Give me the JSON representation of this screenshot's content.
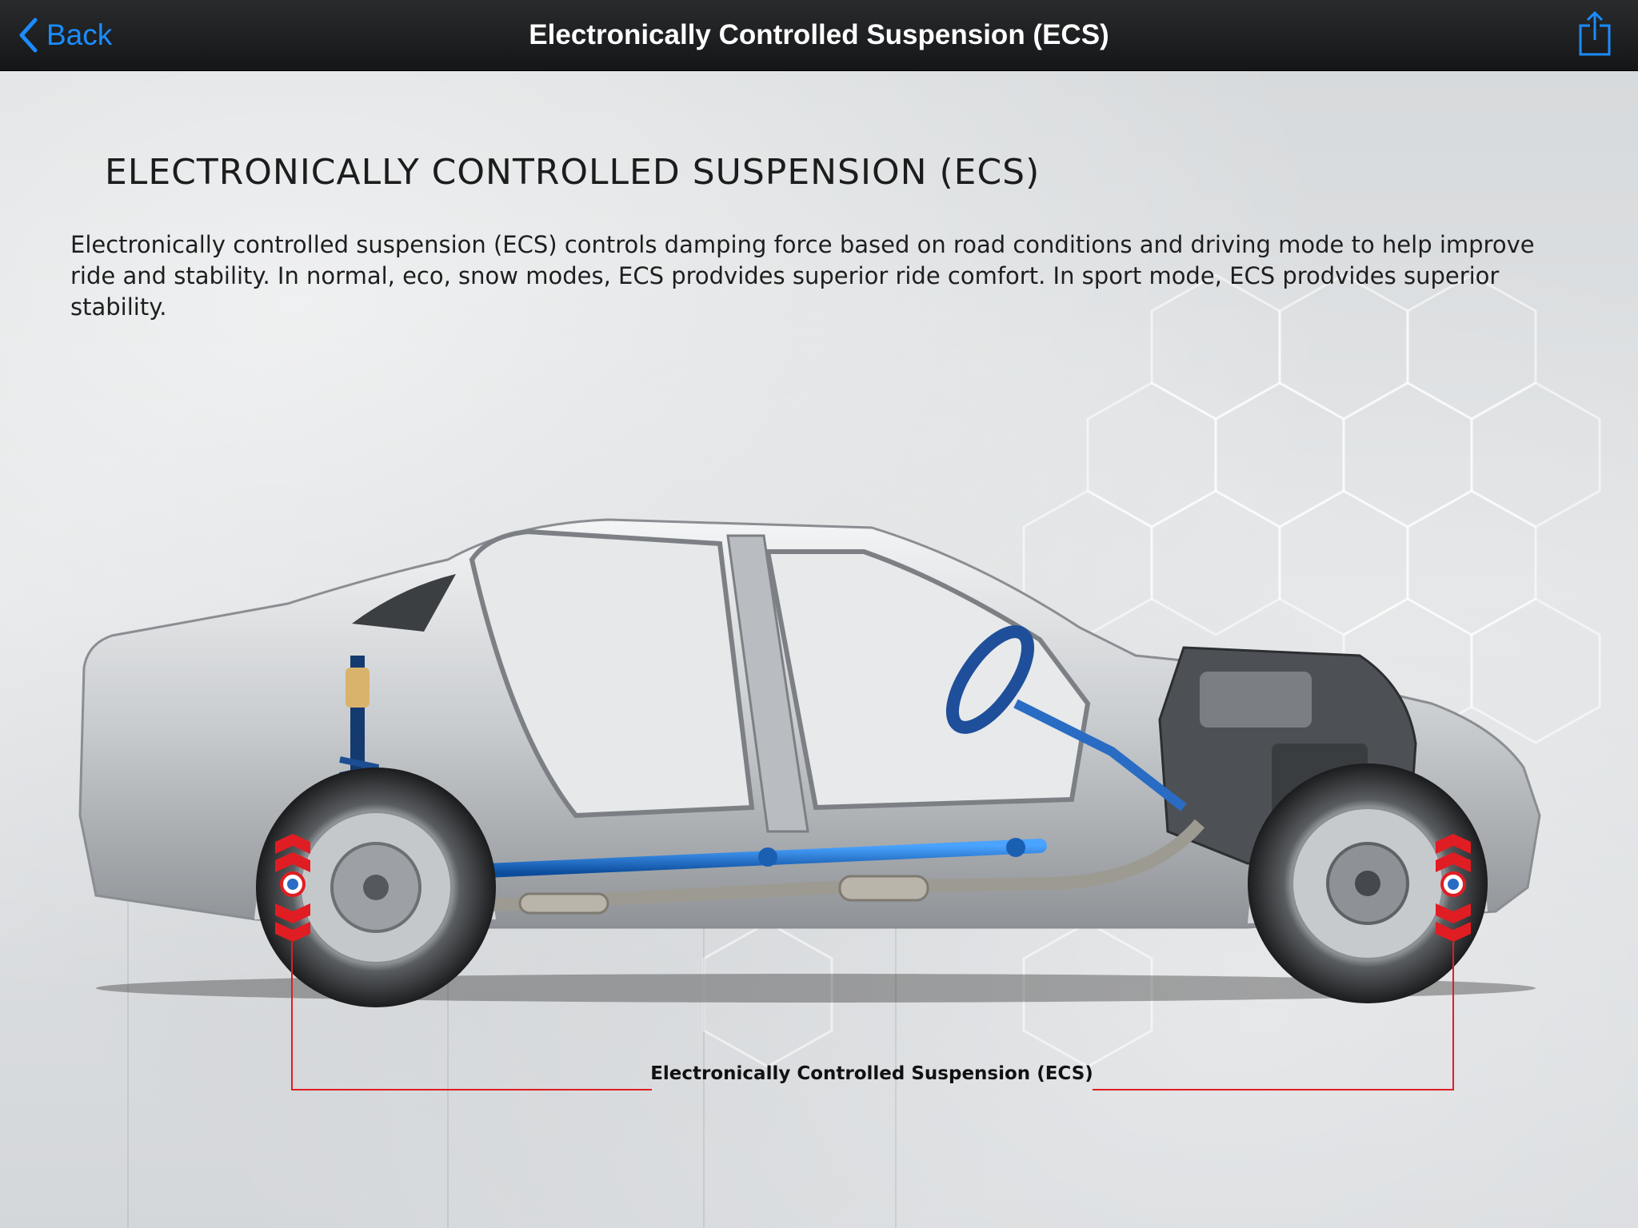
{
  "nav": {
    "back_label": "Back",
    "title": "Electronically Controlled Suspension (ECS)",
    "back_icon": "chevron-left-icon",
    "share_icon": "share-icon",
    "accent_color": "#1a8cff"
  },
  "content": {
    "heading": "ELECTRONICALLY CONTROLLED SUSPENSION (ECS)",
    "description": "Electronically controlled suspension (ECS) controls damping force based on road conditions and driving mode to help improve ride and stability. In normal, eco, snow modes, ECS prodvides superior ride comfort. In sport mode, ECS prodvides superior stability.",
    "callout_label": "Electronically Controlled Suspension (ECS)",
    "highlight_color": "#e01d22"
  }
}
